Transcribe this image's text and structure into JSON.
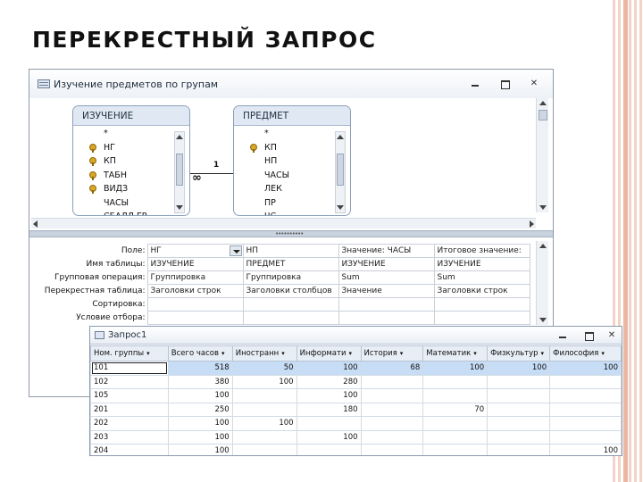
{
  "slide_title": "ПЕРЕКРЕСТНЫЙ ЗАПРОС",
  "design_window": {
    "title": "Изучение предметов по групам",
    "tables": [
      {
        "name": "ИЗУЧЕНИЕ",
        "fields": [
          {
            "name": "*",
            "key": false
          },
          {
            "name": "НГ",
            "key": true
          },
          {
            "name": "КП",
            "key": true
          },
          {
            "name": "ТАБН",
            "key": true
          },
          {
            "name": "ВИДЗ",
            "key": true
          },
          {
            "name": "ЧАСЫ",
            "key": false
          },
          {
            "name": "СБАЛЛ ГР",
            "key": false
          }
        ]
      },
      {
        "name": "ПРЕДМЕТ",
        "fields": [
          {
            "name": "*",
            "key": false
          },
          {
            "name": "КП",
            "key": true
          },
          {
            "name": "НП",
            "key": false
          },
          {
            "name": "ЧАСЫ",
            "key": false
          },
          {
            "name": "ЛЕК",
            "key": false
          },
          {
            "name": "ПР",
            "key": false
          },
          {
            "name": "ЧС",
            "key": false
          }
        ]
      }
    ],
    "relationship": {
      "many": "∞",
      "one": "1"
    },
    "grid_labels": [
      "Поле:",
      "Имя таблицы:",
      "Групповая операция:",
      "Перекрестная таблица:",
      "Сортировка:",
      "Условие отбора:"
    ],
    "grid_columns": [
      [
        "НГ",
        "ИЗУЧЕНИЕ",
        "Группировка",
        "Заголовки строк",
        "",
        ""
      ],
      [
        "НП",
        "ПРЕДМЕТ",
        "Группировка",
        "Заголовки столбцов",
        "",
        ""
      ],
      [
        "Значение: ЧАСЫ",
        "ИЗУЧЕНИЕ",
        "Sum",
        "Значение",
        "",
        ""
      ],
      [
        "Итоговое значение:",
        "ИЗУЧЕНИЕ",
        "Sum",
        "Заголовки строк",
        "",
        ""
      ]
    ]
  },
  "results_window": {
    "title": "Запрос1",
    "columns": [
      "Ном. группы",
      "Всего часов",
      "Иностранн",
      "Информати",
      "История",
      "Математик",
      "Физкультур",
      "Философия"
    ],
    "rows": [
      [
        "101",
        "518",
        "50",
        "100",
        "68",
        "100",
        "100",
        "100"
      ],
      [
        "102",
        "380",
        "100",
        "280",
        "",
        "",
        "",
        ""
      ],
      [
        "105",
        "100",
        "",
        "100",
        "",
        "",
        "",
        ""
      ],
      [
        "201",
        "250",
        "",
        "180",
        "",
        "70",
        "",
        ""
      ],
      [
        "202",
        "100",
        "100",
        "",
        "",
        "",
        "",
        ""
      ],
      [
        "203",
        "100",
        "",
        "100",
        "",
        "",
        "",
        ""
      ],
      [
        "204",
        "100",
        "",
        "",
        "",
        "",
        "",
        "100"
      ]
    ],
    "selected_row": 0
  }
}
